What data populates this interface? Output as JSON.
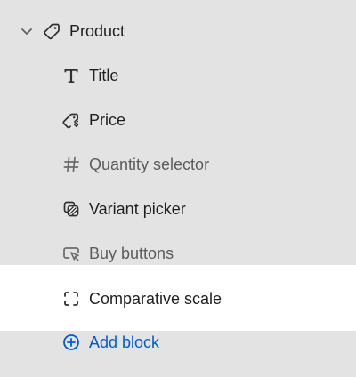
{
  "section": {
    "label": "Product",
    "icon": "tag-icon",
    "expanded": true
  },
  "blocks": [
    {
      "label": "Title",
      "icon": "text-t-icon"
    },
    {
      "label": "Price",
      "icon": "price-tag-icon"
    },
    {
      "label": "Quantity selector",
      "icon": "hash-icon"
    },
    {
      "label": "Variant picker",
      "icon": "variant-squares-icon"
    },
    {
      "label": "Buy buttons",
      "icon": "cursor-button-icon"
    },
    {
      "label": "Comparative scale",
      "icon": "dashed-square-icon",
      "selected": true
    }
  ],
  "add_block": {
    "label": "Add block",
    "icon": "plus-circle-icon"
  },
  "colors": {
    "background": "#e3e3e3",
    "selected_row": "#ffffff",
    "text": "#1f1f1f",
    "muted_text": "#5c5c5c",
    "link": "#005bd3"
  }
}
